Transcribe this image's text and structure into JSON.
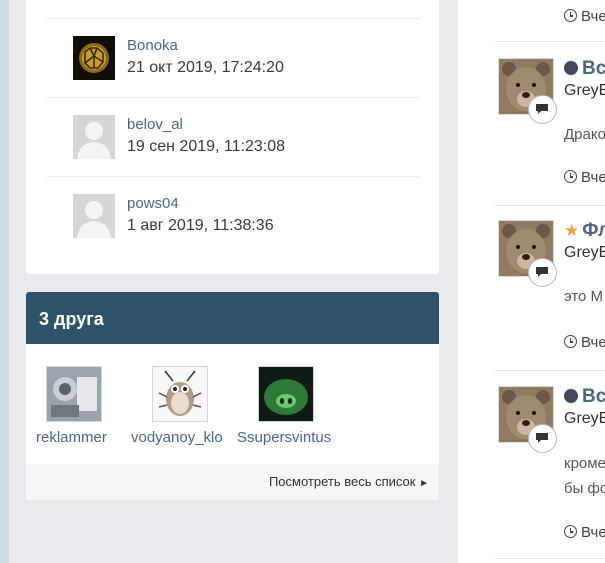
{
  "visitors": [
    {
      "name": "Bonoka",
      "date": "21 окт 2019, 17:24:20",
      "avatar": "bonoka-avatar"
    },
    {
      "name": "belov_al",
      "date": "19 сен 2019, 11:23:08",
      "avatar": "default-avatar"
    },
    {
      "name": "pows04",
      "date": "1 авг 2019, 11:38:36",
      "avatar": "default-avatar"
    }
  ],
  "friends": {
    "title": "3 друга",
    "items": [
      {
        "name": "reklammer"
      },
      {
        "name": "vodyanoy_klo"
      },
      {
        "name": "Ssupersvintus"
      }
    ],
    "view_all": "Посмотреть весь список"
  },
  "activity": {
    "top_time": "Вче",
    "items": [
      {
        "title": "Вс",
        "marker": "dot",
        "author": "GreyE",
        "text": [
          "Драко"
        ],
        "time": "Вче"
      },
      {
        "title": "Фл",
        "marker": "star",
        "author": "GreyE",
        "text": [
          "это М"
        ],
        "time": "Вче"
      },
      {
        "title": "Вс",
        "marker": "dot",
        "author": "GreyE",
        "text": [
          "кроме",
          "бы фо"
        ],
        "time": "Вче"
      }
    ]
  },
  "colors": {
    "accent": "#2e5268",
    "link": "#4d6686"
  }
}
